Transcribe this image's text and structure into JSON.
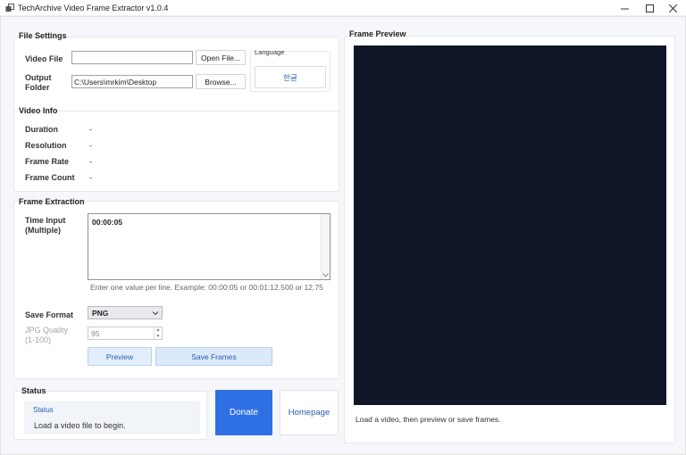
{
  "window": {
    "title": "TechArchive Video Frame Extractor v1.0.4",
    "minimize": "—",
    "maximize": "☐",
    "close": "✕"
  },
  "file_settings": {
    "title": "File Settings",
    "video_file_label": "Video File",
    "video_file_value": "",
    "open_button": "Open File...",
    "output_folder_label_1": "Output",
    "output_folder_label_2": "Folder",
    "output_folder_value": "C:\\Users\\mrkim\\Desktop",
    "browse_button": "Browse...",
    "language_title": "Language",
    "language_button": "한글"
  },
  "video_info": {
    "title": "Video Info",
    "rows": [
      {
        "label": "Duration",
        "value": "-"
      },
      {
        "label": "Resolution",
        "value": "-"
      },
      {
        "label": "Frame Rate",
        "value": "-"
      },
      {
        "label": "Frame Count",
        "value": "-"
      }
    ]
  },
  "frame_extraction": {
    "title": "Frame Extraction",
    "time_input_label_1": "Time Input",
    "time_input_label_2": "(Multiple)",
    "time_input_value": "00:00:05",
    "hint": "Enter one value per line. Example: 00:00:05 or 00:01:12.500 or 12.75",
    "save_format_label": "Save Format",
    "save_format_value": "PNG",
    "jpg_quality_label_1": "JPG Quality",
    "jpg_quality_label_2": "(1-100)",
    "jpg_quality_value": "95",
    "preview_button": "Preview",
    "save_frames_button": "Save Frames"
  },
  "status": {
    "title": "Status",
    "inner_title": "Status",
    "message": "Load a video file to begin."
  },
  "actions": {
    "donate": "Donate",
    "homepage": "Homepage"
  },
  "frame_preview": {
    "title": "Frame Preview",
    "note": "Load a video, then preview or save frames."
  },
  "colors": {
    "accent": "#2f6fe4",
    "preview_bg": "#0f1628",
    "link": "#2a5db0"
  }
}
